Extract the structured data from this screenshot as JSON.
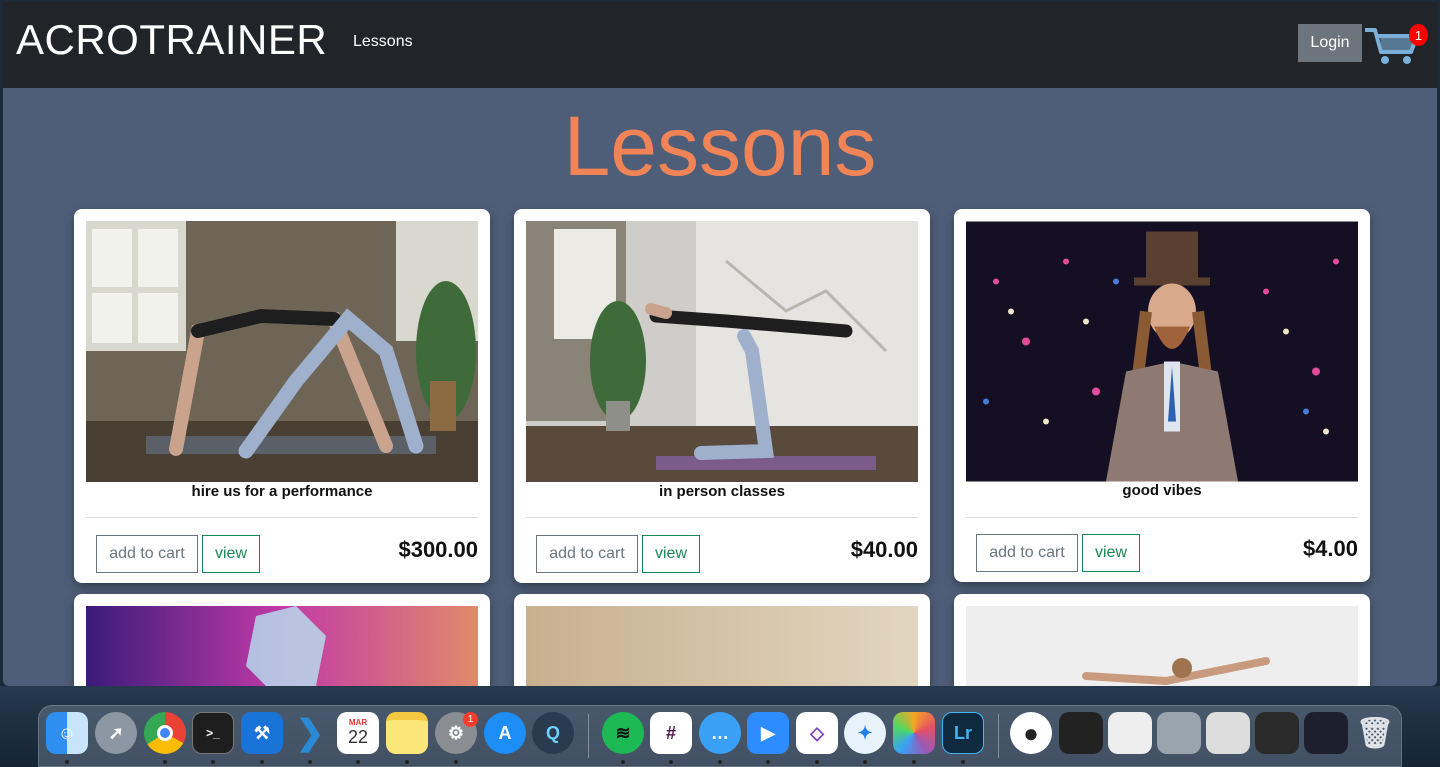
{
  "navbar": {
    "brand": "ACROTRAINER",
    "links": [
      "Lessons"
    ],
    "login_label": "Login",
    "cart_count": "1"
  },
  "page": {
    "title": "Lessons"
  },
  "lessons": [
    {
      "title": "hire us for a performance",
      "price": "$300.00",
      "add_label": "add to cart",
      "view_label": "view"
    },
    {
      "title": "in person classes",
      "price": "$40.00",
      "add_label": "add to cart",
      "view_label": "view"
    },
    {
      "title": "good vibes",
      "price": "$4.00",
      "add_label": "add to cart",
      "view_label": "view"
    }
  ],
  "dock": {
    "apps": [
      "finder-icon",
      "launchpad-icon",
      "chrome-icon",
      "terminal-icon",
      "xcode-icon",
      "vscode-icon",
      "calendar-icon",
      "notes-icon",
      "system-preferences-icon",
      "app-store-icon",
      "quicktime-icon",
      "spotify-icon",
      "slack-icon",
      "messages-icon",
      "zoom-icon",
      "visual-studio-icon",
      "safari-icon",
      "photos-icon",
      "lightroom-icon",
      "user-icon",
      "trash-icon"
    ],
    "calendar_month": "MAR",
    "calendar_day": "22",
    "system_preferences_badge": "1",
    "lightroom_label": "Lr"
  },
  "colors": {
    "navbar": "#212429",
    "page_bg": "#4f5e78",
    "title": "#f08456",
    "view_button": "#198754",
    "add_button": "#6c757d"
  }
}
